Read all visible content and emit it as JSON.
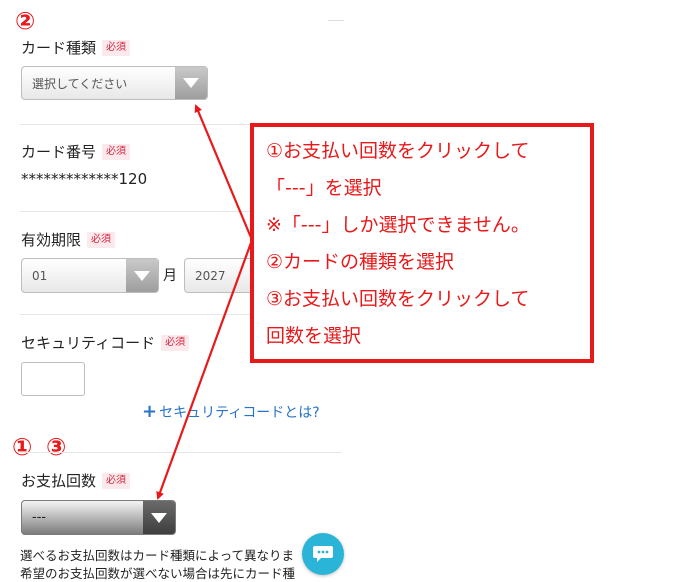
{
  "markers": {
    "step2": "②",
    "step1": "①",
    "step3": "③"
  },
  "required_badge": "必須",
  "card_type": {
    "label": "カード種類",
    "placeholder": "選択してください"
  },
  "card_number": {
    "label": "カード番号",
    "masked_value": "*************120"
  },
  "expiry": {
    "label": "有効期限",
    "month": "01",
    "month_unit": "月",
    "year": "2027"
  },
  "security_code": {
    "label": "セキュリティコード",
    "help_link": "セキュリティコードとは?"
  },
  "payment_count": {
    "label": "お支払回数",
    "value": "---"
  },
  "notes": [
    "選べるお支払回数はカード種類によって異なりま",
    "希望のお支払回数が選べない場合は先にカード種"
  ],
  "instructions": [
    "①お支払い回数をクリックして",
    "「---」を選択",
    "※「---」しか選択できません。",
    "②カードの種類を選択",
    "③お支払い回数をクリックして",
    "回数を選択"
  ],
  "colors": {
    "accent_red": "#e8191a",
    "link_blue": "#2773c7",
    "chat_blue": "#2ab5d8"
  }
}
